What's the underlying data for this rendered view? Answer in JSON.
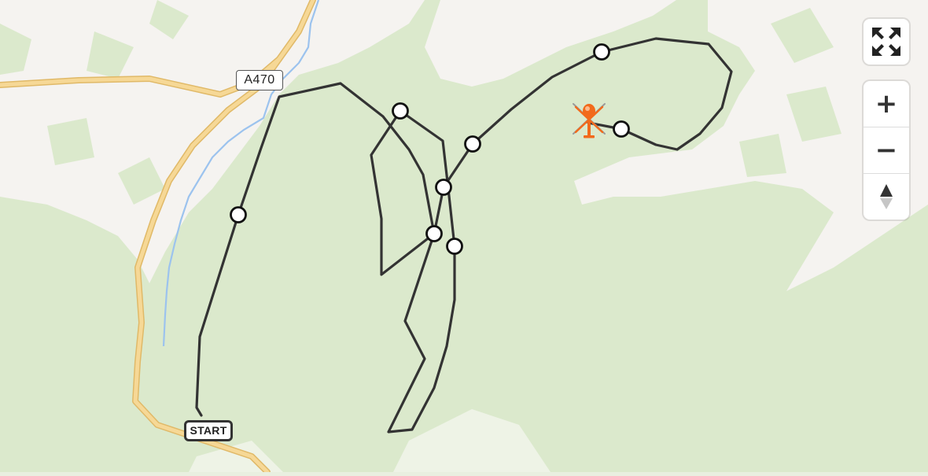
{
  "map": {
    "road_label": "A470",
    "start_label": "START",
    "colors": {
      "forest": "#dbe9cc",
      "open_land": "#f5f3f0",
      "road": "#f6d896",
      "road_edge": "#e0b968",
      "river": "#9cc3ee",
      "route": "#333333",
      "helicopter": "#f26a1b"
    },
    "icons": [
      "helicopter-icon",
      "waypoint-icon"
    ]
  },
  "controls": {
    "fullscreen_icon": "fullscreen-icon",
    "zoom_in_symbol": "+",
    "zoom_out_symbol": "−",
    "compass_icon": "compass-icon"
  }
}
